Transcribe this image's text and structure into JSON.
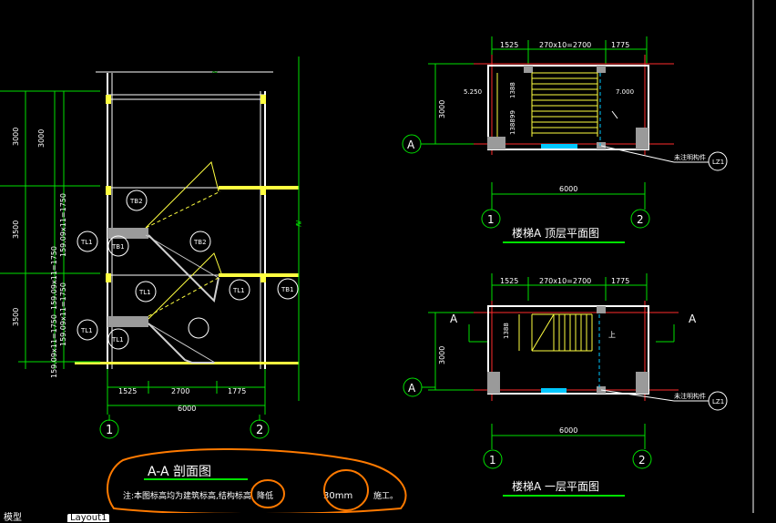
{
  "colors": {
    "background": "#000000",
    "wall": "#ffffff",
    "axis": "#ff2b2b",
    "dimension": "#00e000",
    "stair": "#ffff40",
    "column": "#9a9a9a",
    "window": "#00c8ff",
    "annotation": "#ff7a00"
  },
  "section": {
    "left_dims": [
      "3000",
      "3500",
      "3500"
    ],
    "left_dims_inner": [
      "3000",
      "159.09x11=1750",
      "159.09x11=1750",
      "159.09x11=1750",
      "159.09x11=1750"
    ],
    "bottom_dims": [
      "1525",
      "2700",
      "1775"
    ],
    "total": "6000",
    "axis_1": "1",
    "axis_2": "2",
    "tags": [
      "TB2",
      "TL1",
      "TB1",
      "TB2",
      "TL1",
      "TL1",
      "TB1",
      "TL1",
      "TL1"
    ],
    "title": "A-A 剖面图",
    "note_prefix": "注:本图标高均为建筑标高,结构标高",
    "note_circle1": "降低",
    "note_circle2": "30mm",
    "note_suffix": "施工。"
  },
  "top_plan": {
    "dims_top": [
      "1525",
      "270x10=2700",
      "1775"
    ],
    "left_dim": "3000",
    "level_left": "5.250",
    "level_right": "7.000",
    "inner_dims": [
      "1388",
      "99",
      "1388"
    ],
    "total": "6000",
    "axis_a": "A",
    "axis_1": "1",
    "axis_2": "2",
    "callout": "未注明构件",
    "callout_tag": "LZ1",
    "title": "楼梯A 顶层平面图"
  },
  "ground_plan": {
    "dims_top": [
      "1525",
      "270x10=2700",
      "1775"
    ],
    "left_dim": "3000",
    "inner_dim": "1388",
    "section_mark_left": "A",
    "section_mark_right": "A",
    "total": "6000",
    "axis_a": "A",
    "axis_1": "1",
    "axis_2": "2",
    "callout": "未注明构件",
    "callout_tag": "LZ1",
    "title": "楼梯A 一层平面图",
    "up_label": "上"
  },
  "tabs": {
    "model": "模型",
    "layout1": "Layout1"
  }
}
